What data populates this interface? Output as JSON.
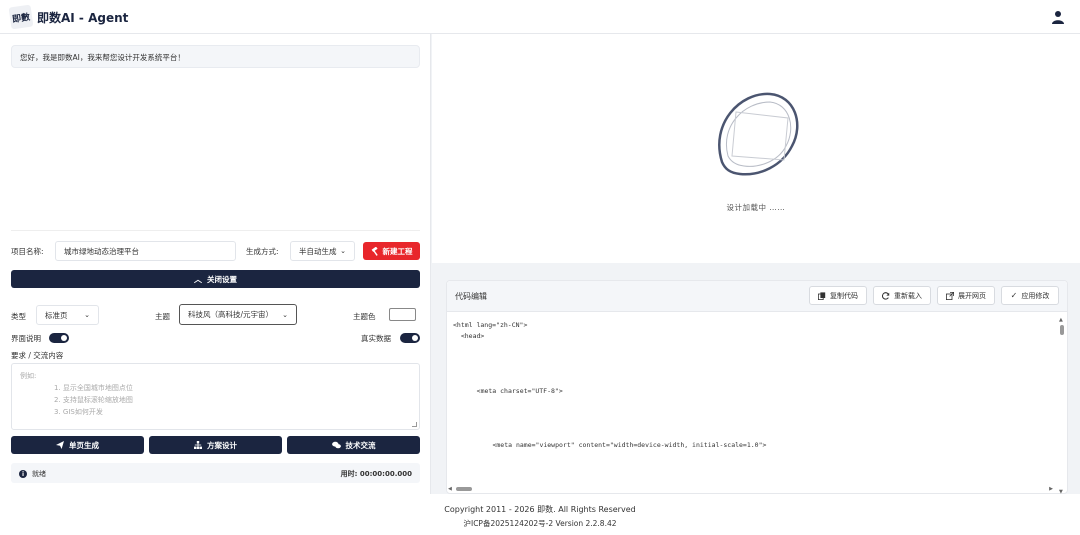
{
  "header": {
    "logo_text": "即數",
    "title": "即数AI - Agent"
  },
  "chat": {
    "welcome": "您好，我是即数AI，我来帮您设计开发系统平台！"
  },
  "project": {
    "name_label": "项目名称:",
    "name_value": "城市绿地动态治理平台",
    "mode_label": "生成方式:",
    "mode_value": "半自动生成",
    "new_button": "新建工程"
  },
  "settings": {
    "close_button": "关闭设置",
    "type_label": "类型",
    "type_value": "标准页",
    "theme_label": "主题",
    "theme_value": "科技风（高科技/元宇宙）",
    "color_label": "主题色",
    "color_value": "#ffffff",
    "ui_desc_label": "界面说明",
    "ui_desc_on": true,
    "real_data_label": "真实数据",
    "real_data_on": true
  },
  "request": {
    "label": "要求 / 交流内容",
    "placeholder_intro": "例如:",
    "placeholder_items": [
      "1. 显示全国城市地图点位",
      "2. 支持鼠标滚轮缩放地图",
      "3. GIS如何开发"
    ]
  },
  "actions": {
    "single_page": "单页生成",
    "design": "方案设计",
    "tech": "技术交流"
  },
  "status": {
    "state": "就绪",
    "elapsed": "用时: 00:00:00.000"
  },
  "preview": {
    "loading_text": "设计加载中 ……"
  },
  "editor": {
    "title": "代码编辑",
    "buttons": {
      "copy": "复制代码",
      "reload": "重新载入",
      "open": "展开网页",
      "apply": "应用修改"
    },
    "lines": [
      "<html lang=\"zh-CN\">",
      "  <head>",
      "    <meta charset=\"UTF-8\">",
      "      <meta name=\"viewport\" content=\"width=device-width, initial-scale=1.0\">"
    ]
  },
  "footer": {
    "copyright": "Copyright 2011 - 2026 即数. All Rights Reserved",
    "icp": "沪ICP备2025124202号-2 Version 2.2.8.42"
  },
  "colors": {
    "navy": "#1b2540",
    "danger": "#e8262b"
  }
}
